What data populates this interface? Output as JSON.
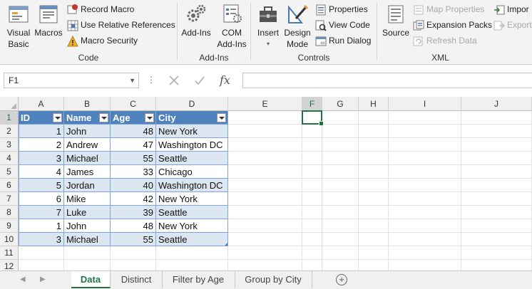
{
  "ribbon": {
    "code": {
      "label": "Code",
      "visual_basic": "Visual\nBasic",
      "macros": "Macros",
      "record_macro": "Record Macro",
      "use_relative": "Use Relative References",
      "macro_security": "Macro Security"
    },
    "addins": {
      "label": "Add-Ins",
      "addins": "Add-Ins",
      "com_addins_1": "COM",
      "com_addins_2": "Add-Ins"
    },
    "controls": {
      "label": "Controls",
      "insert": "Insert",
      "design_mode_1": "Design",
      "design_mode_2": "Mode",
      "properties": "Properties",
      "view_code": "View Code",
      "run_dialog": "Run Dialog"
    },
    "xml": {
      "label": "XML",
      "source": "Source",
      "map_properties": "Map Properties",
      "expansion_packs": "Expansion Packs",
      "refresh_data": "Refresh Data",
      "import": "Impor",
      "export": "Export"
    }
  },
  "formula_bar": {
    "name_box": "F1",
    "fx": "fx",
    "formula": ""
  },
  "grid": {
    "columns": [
      "A",
      "B",
      "C",
      "D",
      "E",
      "F",
      "G",
      "H",
      "I",
      "J"
    ],
    "rows": [
      "1",
      "2",
      "3",
      "4",
      "5",
      "6",
      "7",
      "8",
      "9",
      "10",
      "11",
      "12"
    ],
    "table_headers": [
      "ID",
      "Name",
      "Age",
      "City"
    ],
    "table_rows": [
      [
        "1",
        "John",
        "48",
        "New York"
      ],
      [
        "2",
        "Andrew",
        "47",
        "Washington DC"
      ],
      [
        "3",
        "Michael",
        "55",
        "Seattle"
      ],
      [
        "4",
        "James",
        "33",
        "Chicago"
      ],
      [
        "5",
        "Jordan",
        "40",
        "Washington DC"
      ],
      [
        "6",
        "Mike",
        "42",
        "New York"
      ],
      [
        "7",
        "Luke",
        "39",
        "Seattle"
      ],
      [
        "1",
        "John",
        "48",
        "New York"
      ],
      [
        "3",
        "Michael",
        "55",
        "Seattle"
      ]
    ]
  },
  "sheet_tabs": [
    "Data",
    "Distinct",
    "Filter by Age",
    "Group by City"
  ],
  "active_tab": "Data",
  "colors": {
    "table_header": "#4f81bd",
    "band": "#dce6f1",
    "accent": "#217346"
  }
}
